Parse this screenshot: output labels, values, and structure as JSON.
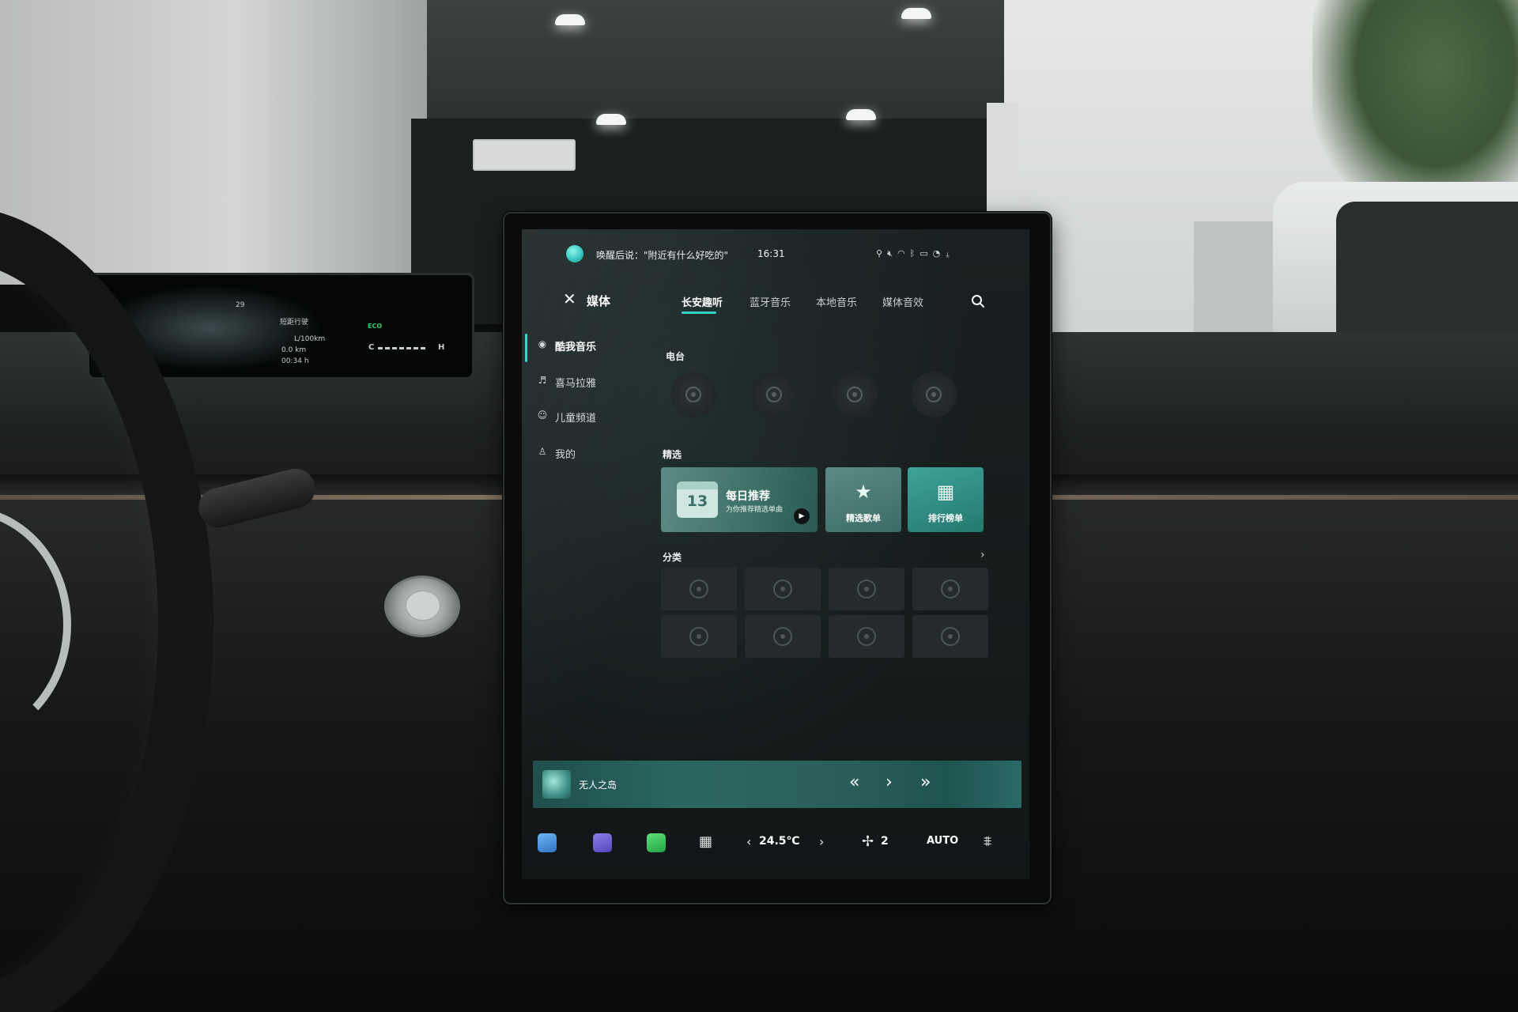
{
  "status_bar": {
    "voice_hint": "唤醒后说：\"附近有什么好吃的\"",
    "time": "16:31",
    "icons": [
      "accessibility-icon",
      "volume-mute-icon",
      "wifi-icon",
      "bluetooth-icon",
      "camera-icon",
      "cellular-icon",
      "microphone-icon"
    ]
  },
  "top_bar": {
    "title": "媒体",
    "tabs": [
      {
        "label": "长安趣听",
        "active": true
      },
      {
        "label": "蓝牙音乐",
        "active": false
      },
      {
        "label": "本地音乐",
        "active": false
      },
      {
        "label": "媒体音效",
        "active": false
      }
    ]
  },
  "sidebar": {
    "items": [
      {
        "label": "酷我音乐",
        "icon": "kuwo-icon",
        "active": true
      },
      {
        "label": "喜马拉雅",
        "icon": "ximalaya-icon",
        "active": false
      },
      {
        "label": "儿童频道",
        "icon": "kids-icon",
        "active": false
      },
      {
        "label": "我的",
        "icon": "user-icon",
        "active": false
      }
    ]
  },
  "sections": {
    "radio": "电台",
    "featured": "精选",
    "category": "分类"
  },
  "featured": {
    "daily": {
      "day": "13",
      "title": "每日推荐",
      "subtitle": "为你推荐精选单曲"
    },
    "playlist": {
      "label": "精选歌单",
      "icon": "star-icon"
    },
    "charts": {
      "label": "排行榜单",
      "icon": "chart-icon"
    }
  },
  "player": {
    "track": "无人之岛"
  },
  "dock": {
    "temperature": "24.5℃",
    "fan_speed": "2",
    "auto_label": "AUTO"
  },
  "cluster": {
    "outside_temp": "29",
    "mode": "短距行驶",
    "consumption_unit": "L/100km",
    "distance": "0.0",
    "distance_unit": "km",
    "duration": "00:34",
    "duration_unit": "h",
    "eco": "ECO",
    "gauge_cold": "C",
    "gauge_hot": "H"
  },
  "colors": {
    "accent": "#2fd0c4",
    "player_bar": "#2b6761",
    "eco": "#2ecf6a"
  }
}
